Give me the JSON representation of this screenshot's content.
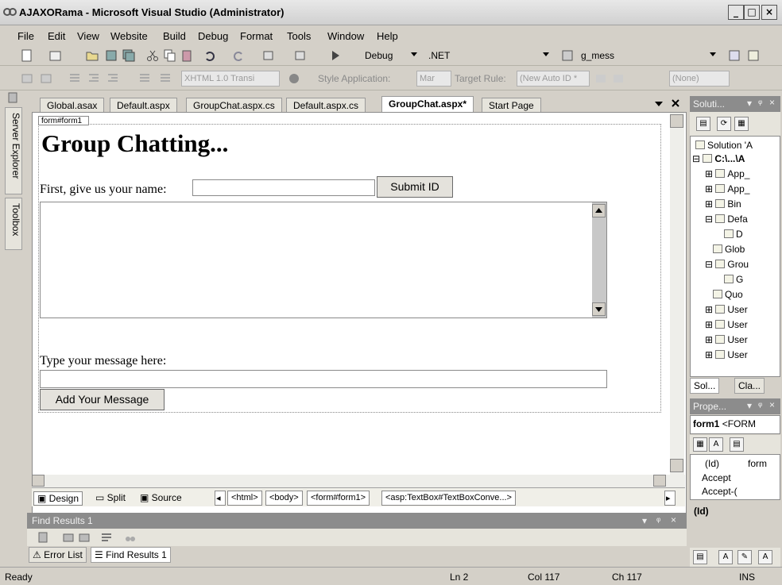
{
  "window": {
    "title": "AJAXORama - Microsoft Visual Studio (Administrator)",
    "min": "_",
    "max": "□",
    "close": "×"
  },
  "menu": [
    "File",
    "Edit",
    "View",
    "Website",
    "Build",
    "Debug",
    "Format",
    "Tools",
    "Window",
    "Help"
  ],
  "toolbar1": {
    "config": "Debug",
    "platform": ".NET",
    "find": "g_mess"
  },
  "toolbar2": {
    "doctype": "XHTML 1.0 Transi",
    "style_app_label": "Style Application:",
    "style_app_value": "Mar",
    "target_rule_label": "Target Rule:",
    "target_rule_value": "(New Auto ID *",
    "none_value": "(None)"
  },
  "left_tabs": {
    "server_explorer": "Server Explorer",
    "toolbox": "Toolbox"
  },
  "doc_tabs": [
    "Global.asax",
    "Default.aspx",
    "GroupChat.aspx.cs",
    "Default.aspx.cs",
    "GroupChat.aspx*",
    "Start Page"
  ],
  "design": {
    "form_tag": "form#form1",
    "heading": "Group Chatting...",
    "name_label": "First, give us your name:",
    "submit_label": "Submit ID",
    "message_label": "Type your message here:",
    "add_label": "Add Your Message"
  },
  "view_modes": {
    "design": "Design",
    "split": "Split",
    "source": "Source"
  },
  "breadcrumbs": [
    "<html>",
    "<body>",
    "<form#form1>",
    "<asp:TextBox#TextBoxConve...>"
  ],
  "find_panel": {
    "title": "Find Results 1",
    "tabs": [
      "Error List",
      "Find Results 1"
    ]
  },
  "status": {
    "ready": "Ready",
    "ln": "Ln 2",
    "col": "Col 117",
    "ch": "Ch 117",
    "ins": "INS"
  },
  "solution": {
    "header": "Soluti...",
    "items": [
      "Solution 'A",
      "C:\\...\\A",
      "App_",
      "App_",
      "Bin",
      "Defa",
      "D",
      "Glob",
      "Grou",
      "G",
      "Quo",
      "User",
      "User",
      "User",
      "User"
    ],
    "tabs": [
      "Sol...",
      "Cla..."
    ]
  },
  "properties": {
    "header": "Prope...",
    "object": "form1",
    "object_type": "<FORM",
    "rows": [
      {
        "name": "(Id)",
        "value": "form"
      },
      {
        "name": "Accept",
        "value": ""
      },
      {
        "name": "Accept-(",
        "value": ""
      }
    ],
    "desc": "(Id)"
  }
}
